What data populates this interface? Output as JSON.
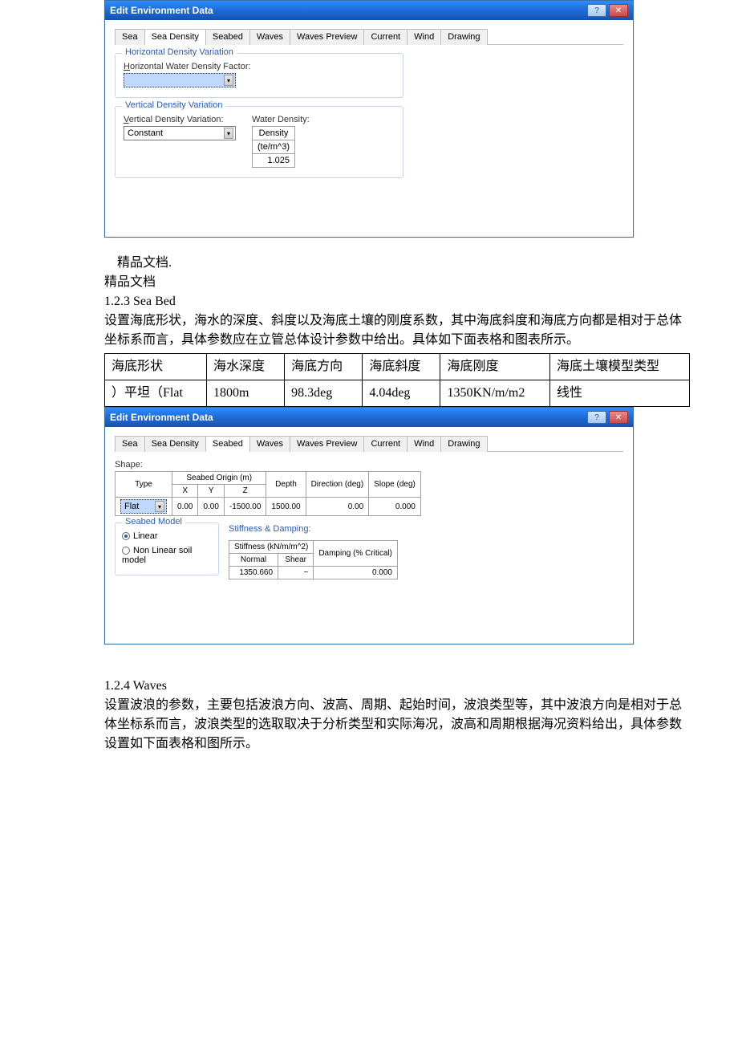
{
  "dialog1": {
    "title": "Edit Environment Data",
    "tabs": [
      "Sea",
      "Sea Density",
      "Seabed",
      "Waves",
      "Waves Preview",
      "Current",
      "Wind",
      "Drawing"
    ],
    "active_tab": 1,
    "horiz": {
      "legend": "Horizontal Density Variation",
      "label": "Horizontal Water Density Factor:",
      "label_u": "H",
      "value": ""
    },
    "vert": {
      "legend": "Vertical Density Variation",
      "label": "Vertical Density Variation:",
      "label_u": "V",
      "value": "Constant",
      "density_label": "Water Density:",
      "density_header1": "Density",
      "density_header2": "(te/m^3)",
      "density_value": "1.025"
    }
  },
  "text1": {
    "l1": "精品文档.",
    "l2": "精品文档",
    "l3": "1.2.3 Sea Bed",
    "l4": "设置海底形状，海水的深度、斜度以及海底土壤的刚度系数，其中海底斜度和海底方向都是相对于总体坐标系而言，具体参数应在立管总体设计参数中给出。具体如下面表格和图表所示。"
  },
  "table1": {
    "headers": [
      "海底形状",
      "海水深度",
      "海底方向",
      "海底斜度",
      "海底刚度",
      "海底土壤模型类型"
    ],
    "row": [
      "）平坦（Flat",
      "1800m",
      "98.3deg",
      "4.04deg",
      "1350KN/m/m2",
      "线性"
    ]
  },
  "dialog2": {
    "title": "Edit Environment Data",
    "tabs": [
      "Sea",
      "Sea Density",
      "Seabed",
      "Waves",
      "Waves Preview",
      "Current",
      "Wind",
      "Drawing"
    ],
    "active_tab": 2,
    "shape_label": "Shape:",
    "grid": {
      "type_h": "Type",
      "origin_h": "Seabed Origin (m)",
      "x_h": "X",
      "y_h": "Y",
      "z_h": "Z",
      "depth_h": "Depth",
      "dir_h": "Direction (deg)",
      "slope_h": "Slope (deg)",
      "type_v": "Flat",
      "x_v": "0.00",
      "y_v": "0.00",
      "z_v": "-1500.00",
      "depth_v": "1500.00",
      "dir_v": "0.00",
      "slope_v": "0.000"
    },
    "model": {
      "legend": "Seabed Model",
      "opt1": "Linear",
      "opt2": "Non Linear soil model"
    },
    "stiff": {
      "legend": "Stiffness & Damping:",
      "s_h": "Stiffness (kN/m/m^2)",
      "d_h": "Damping (% Critical)",
      "normal_h": "Normal",
      "shear_h": "Shear",
      "normal_v": "1350.660",
      "shear_v": "~",
      "damp_v": "0.000"
    }
  },
  "text2": {
    "l1": "1.2.4 Waves",
    "l2": "设置波浪的参数，主要包括波浪方向、波高、周期、起始时间，波浪类型等，其中波浪方向是相对于总体坐标系而言，波浪类型的选取取决于分析类型和实际海况，波高和周期根据海况资料给出，具体参数设置如下面表格和图所示。"
  }
}
